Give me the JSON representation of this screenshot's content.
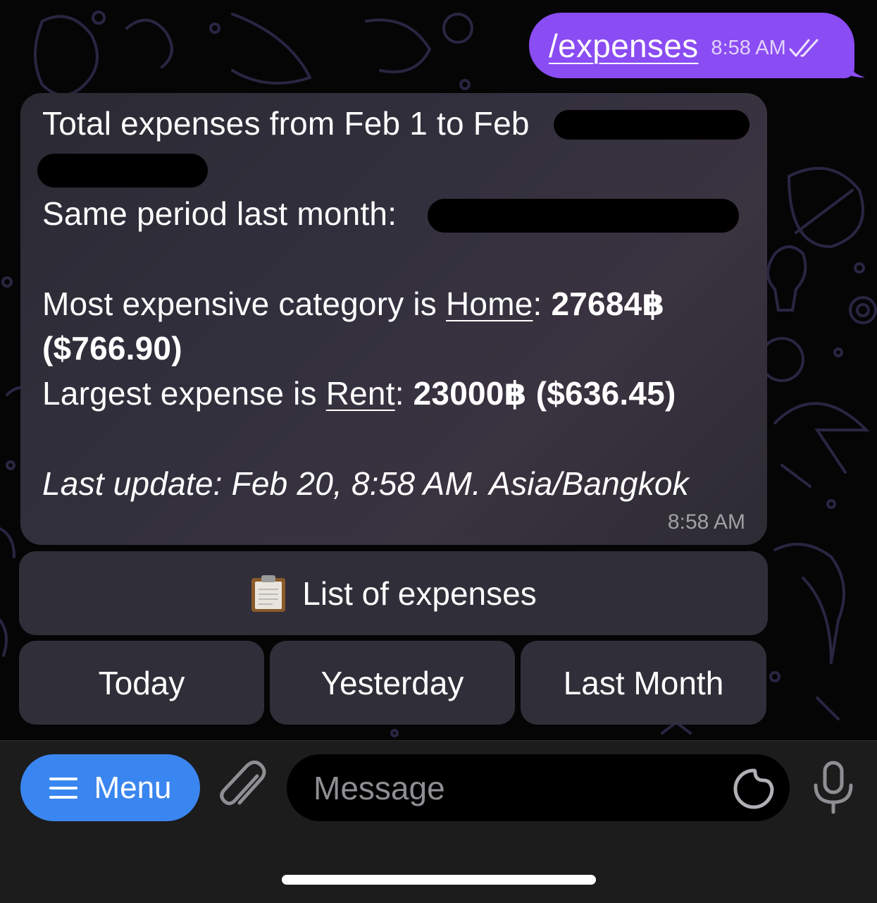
{
  "outgoing": {
    "text": "/expenses",
    "time": "8:58 AM",
    "status_icon": "double-check-icon"
  },
  "incoming": {
    "line1": "Total expenses from Feb 1 to Feb",
    "line2": "Same period last month:",
    "line3_prefix": "Most expensive category is ",
    "line3_link": "Home",
    "line3_colon": ":",
    "line3_value": " 27684฿",
    "line4_value": "($766.90)",
    "line5_prefix": "Largest expense is ",
    "line5_link": "Rent",
    "line5_colon": ":",
    "line5_value": " 23000฿ ($636.45)",
    "line6": "Last update: Feb 20, 8:58 AM. Asia/Bangkok",
    "time": "8:58 AM"
  },
  "keyboard": {
    "list_label": "List of expenses",
    "list_icon": "clipboard-icon",
    "today": "Today",
    "yesterday": "Yesterday",
    "last_month": "Last Month"
  },
  "input_bar": {
    "menu_label": "Menu",
    "placeholder": "Message",
    "attach_icon": "paperclip-icon",
    "sticker_icon": "sticker-icon",
    "mic_icon": "microphone-icon"
  },
  "colors": {
    "outgoing_bubble": "#8a4cf3",
    "menu_button": "#3a86f0",
    "incoming_bubble": "#2e2c36",
    "background": "#050506"
  }
}
